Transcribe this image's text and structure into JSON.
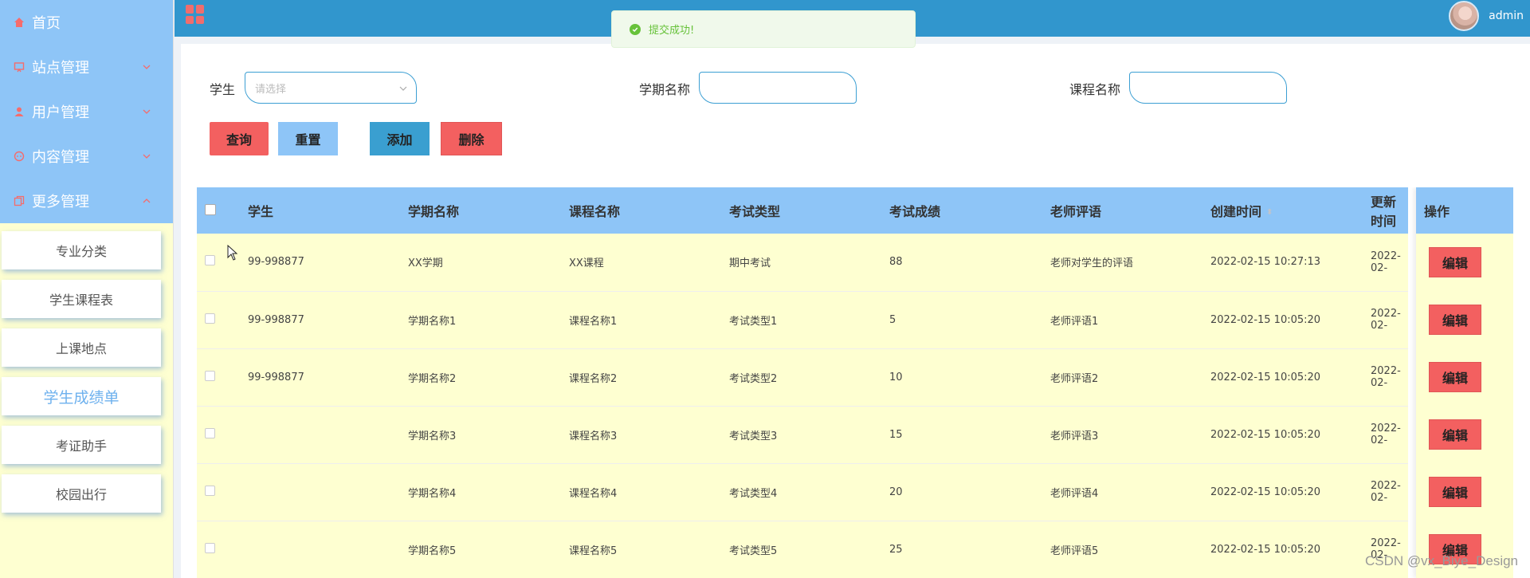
{
  "sidebar": {
    "menu": [
      {
        "label": "首页",
        "icon": "home-icon",
        "chevron": ""
      },
      {
        "label": "站点管理",
        "icon": "site-icon",
        "chevron": "down"
      },
      {
        "label": "用户管理",
        "icon": "user-icon",
        "chevron": "down"
      },
      {
        "label": "内容管理",
        "icon": "chat-icon",
        "chevron": "down"
      },
      {
        "label": "更多管理",
        "icon": "copy-icon",
        "chevron": "up"
      }
    ],
    "submenu": [
      {
        "label": "专业分类",
        "active": false
      },
      {
        "label": "学生课程表",
        "active": false
      },
      {
        "label": "上课地点",
        "active": false
      },
      {
        "label": "学生成绩单",
        "active": true
      },
      {
        "label": "考证助手",
        "active": false
      },
      {
        "label": "校园出行",
        "active": false
      }
    ]
  },
  "header": {
    "username": "admin"
  },
  "toast": {
    "text": "提交成功!"
  },
  "filters": {
    "student_label": "学生",
    "student_placeholder": "请选择",
    "term_label": "学期名称",
    "term_value": "",
    "course_label": "课程名称",
    "course_value": ""
  },
  "buttons": {
    "query": "查询",
    "reset": "重置",
    "add": "添加",
    "delete": "删除",
    "edit": "编辑"
  },
  "table": {
    "columns": [
      "学生",
      "学期名称",
      "课程名称",
      "考试类型",
      "考试成绩",
      "老师评语",
      "创建时间",
      "更新时间"
    ],
    "op_column": "操作",
    "rows": [
      [
        "99-998877",
        "XX学期",
        "XX课程",
        "期中考试",
        "88",
        "老师对学生的评语",
        "2022-02-15 10:27:13",
        "2022-02-"
      ],
      [
        "99-998877",
        "学期名称1",
        "课程名称1",
        "考试类型1",
        "5",
        "老师评语1",
        "2022-02-15 10:05:20",
        "2022-02-"
      ],
      [
        "99-998877",
        "学期名称2",
        "课程名称2",
        "考试类型2",
        "10",
        "老师评语2",
        "2022-02-15 10:05:20",
        "2022-02-"
      ],
      [
        "",
        "学期名称3",
        "课程名称3",
        "考试类型3",
        "15",
        "老师评语3",
        "2022-02-15 10:05:20",
        "2022-02-"
      ],
      [
        "",
        "学期名称4",
        "课程名称4",
        "考试类型4",
        "20",
        "老师评语4",
        "2022-02-15 10:05:20",
        "2022-02-"
      ],
      [
        "",
        "学期名称5",
        "课程名称5",
        "考试类型5",
        "25",
        "老师评语5",
        "2022-02-15 10:05:20",
        "2022-02-"
      ]
    ]
  },
  "watermark": "CSDN @vx_Biye_Design",
  "colors": {
    "header": "#3196cd",
    "menu_bg": "#8ec5f7",
    "row_bg": "#feffd1",
    "danger": "#f36060",
    "accent": "#6eb1ee"
  }
}
